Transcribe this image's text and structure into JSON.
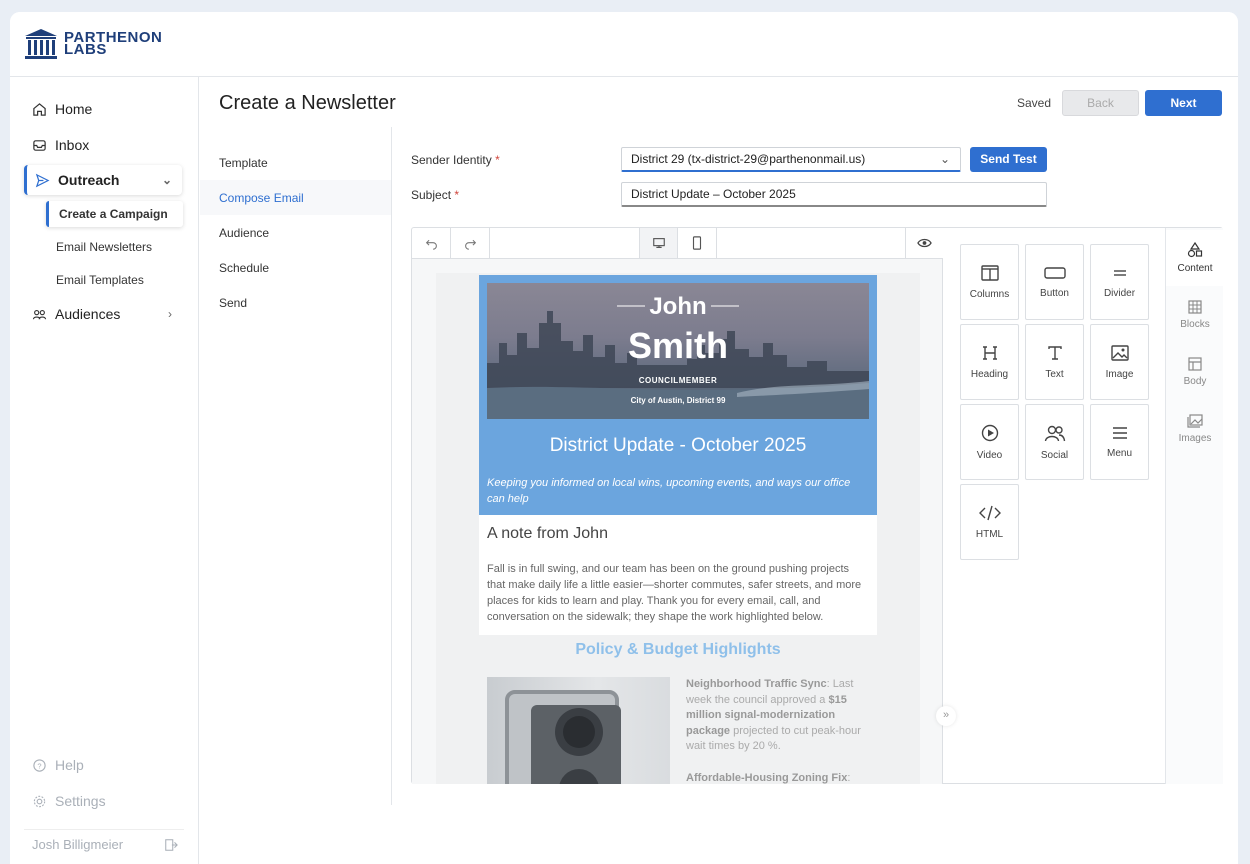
{
  "brand": {
    "line1": "PARTHENON",
    "line2": "LABS"
  },
  "sidebar": {
    "items": [
      {
        "label": "Home",
        "icon": "home-icon"
      },
      {
        "label": "Inbox",
        "icon": "inbox-icon"
      },
      {
        "label": "Outreach",
        "icon": "send-icon"
      },
      {
        "label": "Audiences",
        "icon": "audiences-icon"
      }
    ],
    "sub_items": [
      {
        "label": "Create a Campaign"
      },
      {
        "label": "Email Newsletters"
      },
      {
        "label": "Email Templates"
      }
    ],
    "help": "Help",
    "settings": "Settings",
    "user": "Josh Billigmeier"
  },
  "page": {
    "title": "Create a Newsletter",
    "saved": "Saved",
    "back": "Back",
    "next": "Next"
  },
  "steps": [
    "Template",
    "Compose Email",
    "Audience",
    "Schedule",
    "Send"
  ],
  "form": {
    "sender_label": "Sender Identity",
    "sender_value": "District 29 (tx-district-29@parthenonmail.us)",
    "send_test": "Send Test",
    "subject_label": "Subject",
    "subject_value": "District Update – October 2025",
    "required_mark": "*"
  },
  "email": {
    "name_first": "John",
    "name_last": "Smith",
    "role": "COUNCILMEMBER",
    "city": "City of Austin, District 99",
    "title": "District Update - October 2025",
    "tagline": "Keeping you informed on local wins, upcoming events, and ways our office can help",
    "note_heading": "A note from John",
    "note_body": "Fall is in full swing, and our team has been on the ground pushing projects that make daily life a little easier—shorter commutes, safer streets, and more places for kids to learn and play. Thank you for every email, call, and conversation on the sidewalk; they shape the work highlighted below.",
    "policy_heading": "Policy & Budget Highlights",
    "item1_title": "Neighborhood Traffic Sync",
    "item1_a": ": Last week the council approved a ",
    "item1_bold": "$15 million signal-modernization package",
    "item1_b": " projected to cut peak-hour wait times by 20 %.",
    "item2_title": "Affordable-Housing Zoning Fix",
    "item2_a": ":"
  },
  "tiles": [
    {
      "label": "Columns",
      "icon": "columns-icon"
    },
    {
      "label": "Button",
      "icon": "button-icon"
    },
    {
      "label": "Divider",
      "icon": "divider-icon"
    },
    {
      "label": "Heading",
      "icon": "heading-icon"
    },
    {
      "label": "Text",
      "icon": "text-icon"
    },
    {
      "label": "Image",
      "icon": "image-icon"
    },
    {
      "label": "Video",
      "icon": "video-icon"
    },
    {
      "label": "Social",
      "icon": "social-icon"
    },
    {
      "label": "Menu",
      "icon": "menu-icon"
    },
    {
      "label": "HTML",
      "icon": "html-icon"
    }
  ],
  "panel_tabs": [
    {
      "label": "Content",
      "icon": "content-icon"
    },
    {
      "label": "Blocks",
      "icon": "blocks-icon"
    },
    {
      "label": "Body",
      "icon": "body-icon"
    },
    {
      "label": "Images",
      "icon": "images-icon"
    }
  ],
  "colors": {
    "accent": "#2f6fd0",
    "hero": "#6ba5de"
  }
}
